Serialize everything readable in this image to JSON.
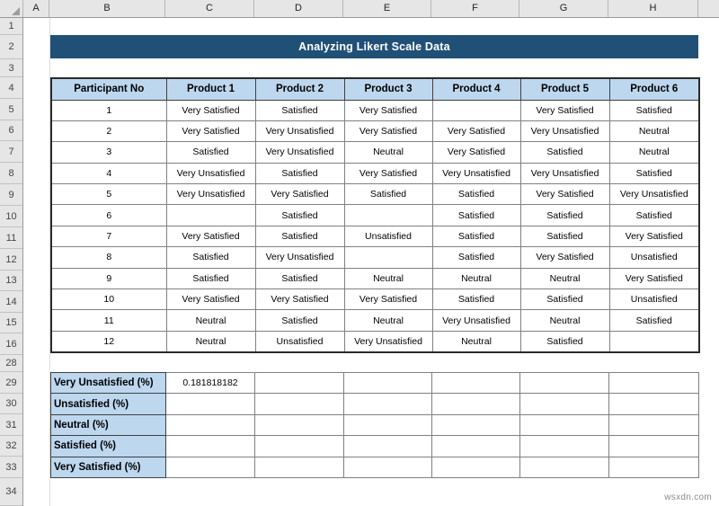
{
  "app": {
    "type": "spreadsheet",
    "watermark": "wsxdn.com"
  },
  "grid": {
    "column_letters": [
      "A",
      "B",
      "C",
      "D",
      "E",
      "F",
      "G",
      "H"
    ],
    "row_numbers": [
      "1",
      "2",
      "3",
      "4",
      "5",
      "6",
      "7",
      "8",
      "9",
      "10",
      "11",
      "12",
      "13",
      "14",
      "15",
      "16",
      "28",
      "29",
      "30",
      "31",
      "32",
      "33",
      "34"
    ]
  },
  "title": {
    "text": "Analyzing Likert Scale Data",
    "fill_color": "#215077",
    "text_color": "#ffffff"
  },
  "main_table": {
    "header_fill": "#bdd7ee",
    "headers": [
      "Participant No",
      "Product 1",
      "Product 2",
      "Product 3",
      "Product 4",
      "Product 5",
      "Product 6"
    ],
    "rows": [
      [
        "1",
        "Very Satisfied",
        "Satisfied",
        "Very Satisfied",
        "",
        "Very Satisfied",
        "Satisfied"
      ],
      [
        "2",
        "Very Satisfied",
        "Very Unsatisfied",
        "Very Satisfied",
        "Very Satisfied",
        "Very Unsatisfied",
        "Neutral"
      ],
      [
        "3",
        "Satisfied",
        "Very Unsatisfied",
        "Neutral",
        "Very Satisfied",
        "Satisfied",
        "Neutral"
      ],
      [
        "4",
        "Very Unsatisfied",
        "Satisfied",
        "Very Satisfied",
        "Very Unsatisfied",
        "Very Unsatisfied",
        "Satisfied"
      ],
      [
        "5",
        "Very Unsatisfied",
        "Very Satisfied",
        "Satisfied",
        "Satisfied",
        "Very Satisfied",
        "Very Unsatisfied"
      ],
      [
        "6",
        "",
        "Satisfied",
        "",
        "Satisfied",
        "Satisfied",
        "Satisfied"
      ],
      [
        "7",
        "Very Satisfied",
        "Satisfied",
        "Unsatisfied",
        "Satisfied",
        "Satisfied",
        "Very Satisfied"
      ],
      [
        "8",
        "Satisfied",
        "Very Unsatisfied",
        "",
        "Satisfied",
        "Very Satisfied",
        "Unsatisfied"
      ],
      [
        "9",
        "Satisfied",
        "Satisfied",
        "Neutral",
        "Neutral",
        "Neutral",
        "Very Satisfied"
      ],
      [
        "10",
        "Very Satisfied",
        "Very Satisfied",
        "Very Satisfied",
        "Satisfied",
        "Satisfied",
        "Unsatisfied"
      ],
      [
        "11",
        "Neutral",
        "Satisfied",
        "Neutral",
        "Very Unsatisfied",
        "Neutral",
        "Satisfied"
      ],
      [
        "12",
        "Neutral",
        "Unsatisfied",
        "Very Unsatisfied",
        "Neutral",
        "Satisfied",
        ""
      ]
    ]
  },
  "summary_table": {
    "label_fill": "#bdd7ee",
    "rows": [
      {
        "label": "Very Unsatisfied (%)",
        "values": [
          "0.181818182",
          "",
          "",
          "",
          "",
          ""
        ]
      },
      {
        "label": "Unsatisfied (%)",
        "values": [
          "",
          "",
          "",
          "",
          "",
          ""
        ]
      },
      {
        "label": "Neutral (%)",
        "values": [
          "",
          "",
          "",
          "",
          "",
          ""
        ]
      },
      {
        "label": "Satisfied (%)",
        "values": [
          "",
          "",
          "",
          "",
          "",
          ""
        ]
      },
      {
        "label": "Very Satisfied (%)",
        "values": [
          "",
          "",
          "",
          "",
          "",
          ""
        ]
      }
    ]
  }
}
